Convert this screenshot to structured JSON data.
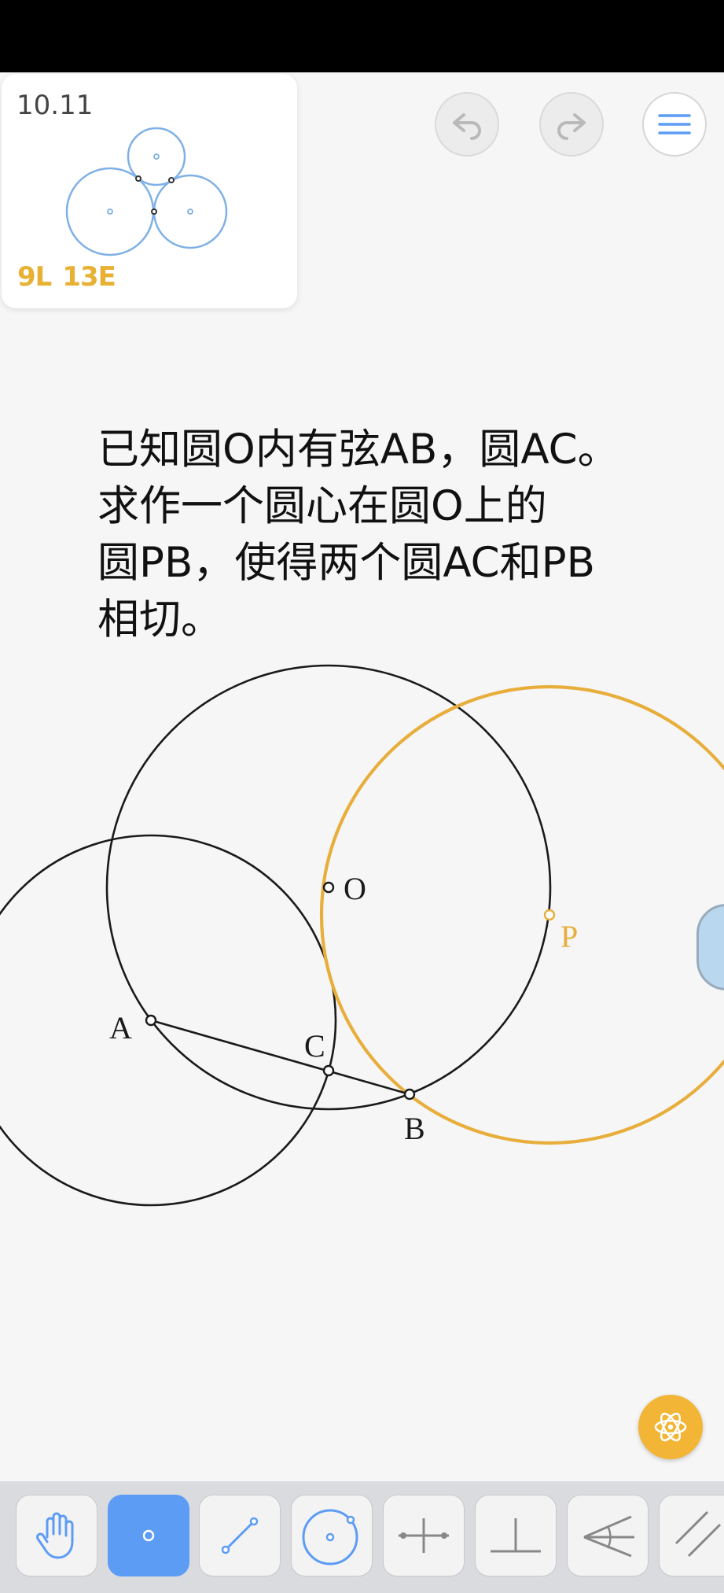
{
  "level": {
    "number": "10.11",
    "score_l": "9L",
    "score_e": "13E"
  },
  "toolbar_top": {
    "undo_icon": "undo-icon",
    "redo_icon": "redo-icon",
    "menu_icon": "hamburger-menu-icon"
  },
  "problem": {
    "line1": "已知圆O内有弦AB，圆AC。",
    "line2": "求作一个圆心在圆O上的",
    "line3": "圆PB，使得两个圆AC和PB",
    "line4": "相切。"
  },
  "figure": {
    "labels": {
      "O": "O",
      "P": "P",
      "A": "A",
      "B": "B",
      "C": "C"
    },
    "colors": {
      "given": "#1a1a1a",
      "solution": "#e8ae3c"
    }
  },
  "tools": [
    {
      "name": "hand",
      "icon": "hand-icon"
    },
    {
      "name": "point",
      "icon": "point-icon",
      "active": true
    },
    {
      "name": "line",
      "icon": "line-segment-icon"
    },
    {
      "name": "circle",
      "icon": "circle-icon"
    },
    {
      "name": "perpendicular-bisector",
      "icon": "perpendicular-bisector-icon"
    },
    {
      "name": "perpendicular",
      "icon": "perpendicular-icon"
    },
    {
      "name": "angle-bisector",
      "icon": "angle-bisector-icon"
    },
    {
      "name": "parallel",
      "icon": "parallel-icon"
    }
  ],
  "colors": {
    "accent": "#5d9cf5",
    "score": "#e8b133",
    "hint": "#f2b535"
  }
}
